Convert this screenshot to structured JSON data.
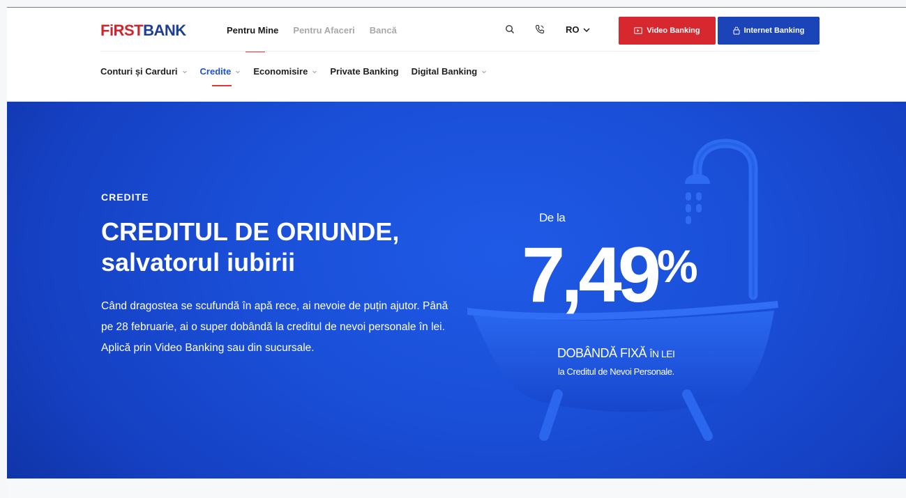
{
  "brand": {
    "logo_first": "FiRST",
    "logo_bank": "BANK",
    "red": "#d0232e",
    "blue": "#1c3f94"
  },
  "main_nav": {
    "items": [
      {
        "label": "Pentru Mine",
        "active": true
      },
      {
        "label": "Pentru Afaceri",
        "active": false
      },
      {
        "label": "Bancă",
        "active": false
      }
    ]
  },
  "tools": {
    "search_icon": "search-icon",
    "phone_icon": "phone-icon",
    "language": "RO",
    "video_banking_label": "Video Banking",
    "internet_banking_label": "Internet Banking",
    "video_banking_color": "#d8282f",
    "internet_banking_color": "#1b44b8"
  },
  "sub_nav": {
    "items": [
      {
        "label": "Conturi și Carduri",
        "has_dropdown": true,
        "active": false
      },
      {
        "label": "Credite",
        "has_dropdown": true,
        "active": true
      },
      {
        "label": "Economisire",
        "has_dropdown": true,
        "active": false
      },
      {
        "label": "Private Banking",
        "has_dropdown": false,
        "active": false
      },
      {
        "label": "Digital Banking",
        "has_dropdown": true,
        "active": false
      }
    ]
  },
  "hero": {
    "kicker": "CREDITE",
    "title_line1": "CREDITUL DE ORIUNDE,",
    "title_line2": "salvatorul iubirii",
    "body": "Când dragostea se scufundă în apă rece, ai nevoie de puțin ajutor. Până pe 28 februarie, ai o super dobândă la creditul de nevoi personale în lei. Aplică prin Video Banking sau din sucursale.",
    "promo_prefix": "De la",
    "rate_main": "7,49",
    "rate_pct": "%",
    "fixed_big": "DOBÂNDĂ FIXĂ",
    "fixed_small": "ÎN LEI",
    "fixed_sub": "la Creditul de Nevoi Personale.",
    "background_color": "#1a4fd8"
  }
}
